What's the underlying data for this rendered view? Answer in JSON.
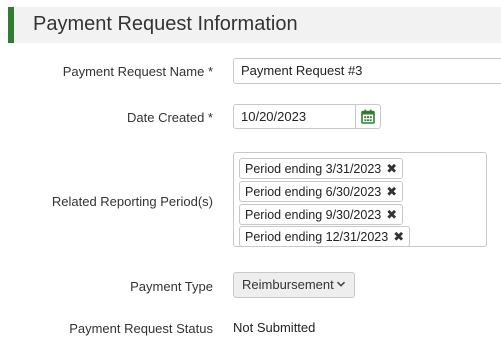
{
  "section": {
    "title": "Payment Request Information"
  },
  "fields": {
    "name": {
      "label": "Payment Request Name *",
      "value": "Payment Request #3"
    },
    "date_created": {
      "label": "Date Created *",
      "value": "10/20/2023",
      "icon": "calendar-icon"
    },
    "related_periods": {
      "label": "Related Reporting Period(s)",
      "tags": [
        "Period ending 3/31/2023",
        "Period ending 6/30/2023",
        "Period ending 9/30/2023",
        "Period ending 12/31/2023"
      ],
      "remove_icon": "close-icon"
    },
    "payment_type": {
      "label": "Payment Type",
      "selected": "Reimbursement",
      "icon": "chevron-down-icon"
    },
    "status": {
      "label": "Payment Request Status",
      "value": "Not Submitted"
    }
  },
  "colors": {
    "accent": "#2e7d32",
    "header_bg": "#f2f2f2",
    "border": "#c8c8c8"
  }
}
